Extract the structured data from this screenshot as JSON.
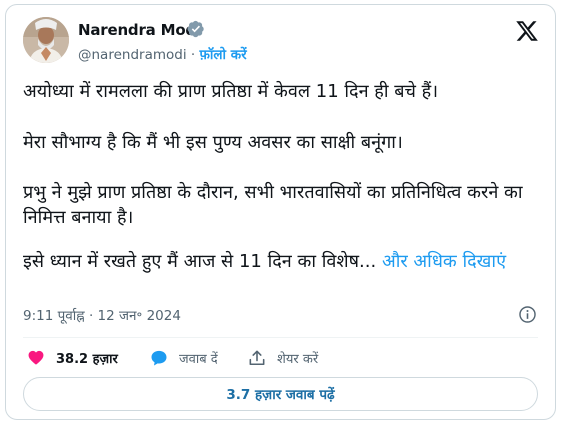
{
  "author": {
    "name": "Narendra Modi",
    "handle": "@narendramodi",
    "separator": "·",
    "follow_label": "फ़ॉलो करें"
  },
  "tweet": {
    "para1": "अयोध्या में रामलला की प्राण प्रतिष्ठा में केवल 11 दिन ही बचे हैं।",
    "para2": "मेरा सौभाग्य है कि मैं भी इस पुण्य अवसर का साक्षी बनूंगा।",
    "para3": "प्रभु ने मुझे प्राण प्रतिष्ठा के दौरान, सभी भारतवासियों का प्रतिनिधित्व करने का निमित्त बनाया है।",
    "para4": "इसे ध्यान में रखते हुए मैं आज से 11 दिन का विशेष...",
    "show_more": "और अधिक दिखाएं",
    "timestamp": "9:11 पूर्वाह्न · 12 जन॰ 2024"
  },
  "actions": {
    "likes": "38.2 हज़ार",
    "reply": "जवाब दें",
    "share": "शेयर करें"
  },
  "replies_button": "3.7 हज़ार जवाब पढ़ें",
  "colors": {
    "accent": "#1d9bf0",
    "like": "#f91880",
    "verified": "#829aab",
    "muted": "#536471",
    "border": "#cfd9de"
  },
  "icons": [
    "verified-badge-icon",
    "x-logo-icon",
    "info-icon",
    "heart-icon",
    "reply-bubble-icon",
    "share-icon"
  ]
}
